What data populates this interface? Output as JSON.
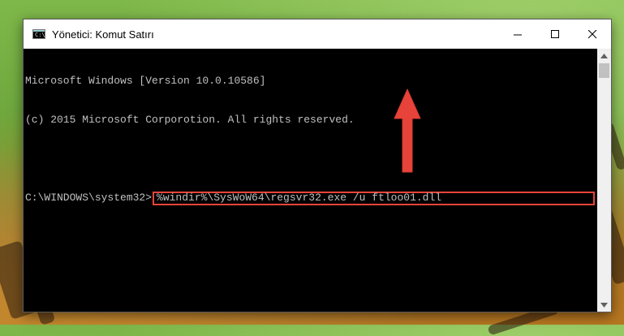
{
  "window": {
    "title": "Yönetici: Komut Satırı",
    "icon": "cmd-icon",
    "icon_glyph": "C:\\"
  },
  "console": {
    "lines": [
      "Microsoft Windows [Version 10.0.10586]",
      "(c) 2015 Microsoft Corporotion. All rights reserved.",
      ""
    ],
    "prompt": "C:\\WINDOWS\\system32>",
    "command": "%windir%\\SysWoW64\\regsvr32.exe /u ftloo01.dll"
  },
  "annotation": {
    "arrow_color": "#e8433a",
    "highlight_color": "#e8433a"
  }
}
